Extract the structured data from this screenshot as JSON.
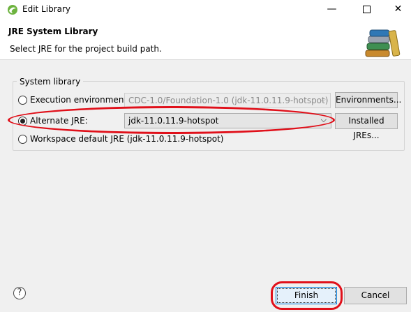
{
  "window": {
    "title": "Edit Library",
    "min_glyph": "—",
    "close_glyph": "✕"
  },
  "header": {
    "title": "JRE System Library",
    "description": "Select JRE for the project build path.",
    "icon": "library-books-icon"
  },
  "group": {
    "label": "System library"
  },
  "options": {
    "execution_environment": {
      "label": "Execution environment:",
      "selected": false,
      "value": "CDC-1.0/Foundation-1.0 (jdk-11.0.11.9-hotspot)",
      "enabled": false,
      "button": "Environments..."
    },
    "alternate_jre": {
      "label": "Alternate JRE:",
      "selected": true,
      "value": "jdk-11.0.11.9-hotspot",
      "button": "Installed JREs..."
    },
    "workspace_default": {
      "label": "Workspace default JRE (jdk-11.0.11.9-hotspot)",
      "selected": false
    }
  },
  "footer": {
    "help": "?",
    "finish": "Finish",
    "cancel": "Cancel"
  },
  "colors": {
    "highlight": "#e0101a",
    "default_button_border": "#0078d7"
  }
}
